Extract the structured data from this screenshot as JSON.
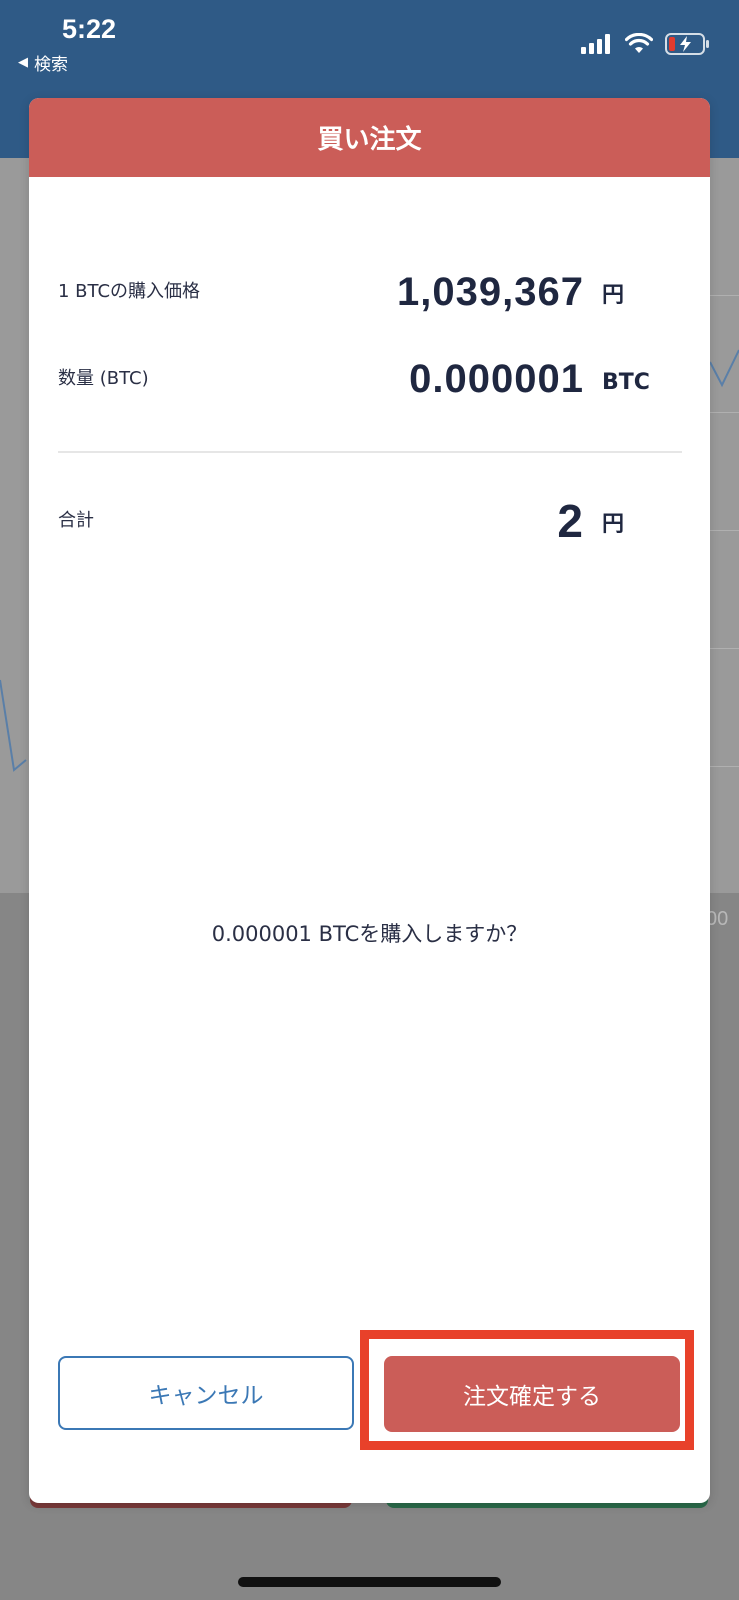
{
  "status_bar": {
    "time": "5:22",
    "back_label": "検索",
    "back_icon": "triangle-left-icon",
    "battery_color": "#e23b2e"
  },
  "background": {
    "axis_partial": "00"
  },
  "modal": {
    "title": "買い注文",
    "header_color": "#cb5d58",
    "price": {
      "label": "1 BTCの購入価格",
      "value": "1,039,367",
      "unit": "円"
    },
    "quantity": {
      "label": "数量 (BTC)",
      "value": "0.000001",
      "unit": "BTC"
    },
    "total": {
      "label": "合計",
      "value": "2",
      "unit": "円"
    },
    "confirm_question": "0.000001 BTCを購入しますか？",
    "cancel_label": "キャンセル",
    "confirm_label": "注文確定する",
    "highlight_color": "#e8412a"
  }
}
